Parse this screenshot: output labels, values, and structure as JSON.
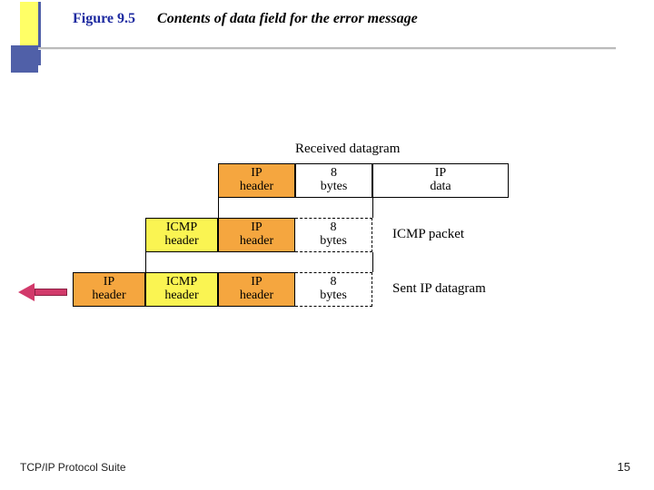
{
  "header": {
    "figure_number": "Figure 9.5",
    "caption": "Contents of data field for the error message"
  },
  "diagram": {
    "received_label": "Received datagram",
    "icmp_packet_label": "ICMP packet",
    "sent_label": "Sent IP datagram",
    "cells": {
      "ip_header": "IP\nheader",
      "icmp_header": "ICMP\nheader",
      "eight_bytes": "8\nbytes",
      "ip_data": "IP\ndata"
    }
  },
  "footer": {
    "left": "TCP/IP Protocol Suite",
    "page": "15"
  }
}
